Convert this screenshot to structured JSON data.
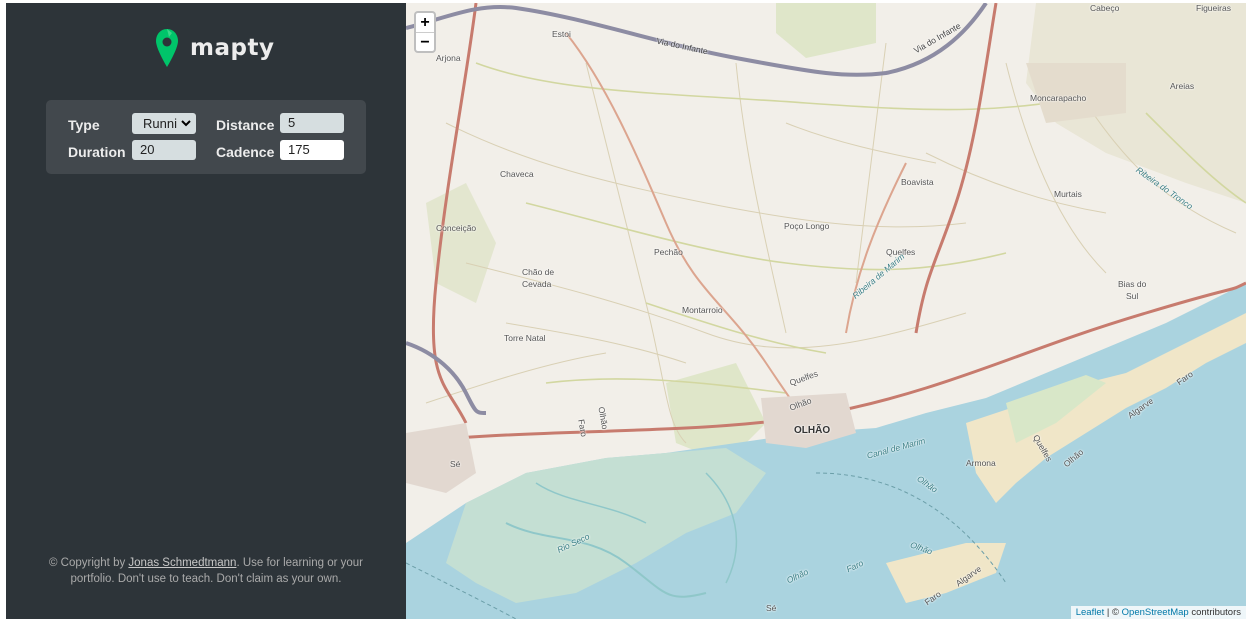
{
  "app": {
    "name": "mapty"
  },
  "form": {
    "type_label": "Type",
    "type_value": "Running",
    "type_value_visible": "Runni",
    "distance_label": "Distance",
    "distance_value": "5",
    "duration_label": "Duration",
    "duration_value": "20",
    "cadence_label": "Cadence",
    "cadence_value": "175"
  },
  "footer": {
    "prefix": "© Copyright by ",
    "author": "Jonas Schmedtmann",
    "suffix": ". Use for learning or your portfolio. Don't use to teach. Don't claim as your own."
  },
  "map": {
    "zoom_in": "+",
    "zoom_out": "−",
    "attribution": {
      "leaflet": "Leaflet",
      "separator": " | © ",
      "osm": "OpenStreetMap",
      "contributors": " contributors"
    },
    "places": {
      "estoi": "Estoi",
      "ariona": "Arjona",
      "via_infante_1": "Via do Infante",
      "via_infante_2": "Via do Infante",
      "cabeco": "Cabeço",
      "figueiras": "Figueiras",
      "moncarapacho": "Moncarapacho",
      "areias": "Areias",
      "chaveca": "Chaveca",
      "boavista": "Boavista",
      "murtais": "Murtais",
      "ribeira_tronco": "Ribeira do Tronco",
      "conceicao": "Conceição",
      "poco_longo": "Poço Longo",
      "pechao": "Pechão",
      "quelfes": "Quelfes",
      "chao_de": "Chão de",
      "cevada": "Cevada",
      "ribeira_marim": "Ribeira de Marim",
      "bias": "Bias do",
      "sul": "Sul",
      "torre_natal": "Torre Natal",
      "montarroio": "Montarroio",
      "olhao": "OLHÃO",
      "se": "Sé",
      "faro_1": "Faro",
      "faro_2": "Faro",
      "faro_3": "Faro",
      "olhao_2": "Olhão",
      "olhao_3": "Olhão",
      "olhao_4": "Olhão",
      "armona": "Armona",
      "algarve_1": "Algarve",
      "algarve_2": "Algarve",
      "canal_marim": "Canal de Marim",
      "ribeira_seco": "Rio Seco",
      "quelfes_2": "Quelfes",
      "faro_4": "Faro",
      "olhao_5": "Olhão",
      "se_2": "Sé"
    }
  },
  "colors": {
    "sidebar": "#2d3439",
    "form_bg": "#42484d",
    "brand_green": "#00c46a",
    "sea": "#aad3df",
    "motorway": "#8d8ca3",
    "trunk": "#c77b6e"
  }
}
